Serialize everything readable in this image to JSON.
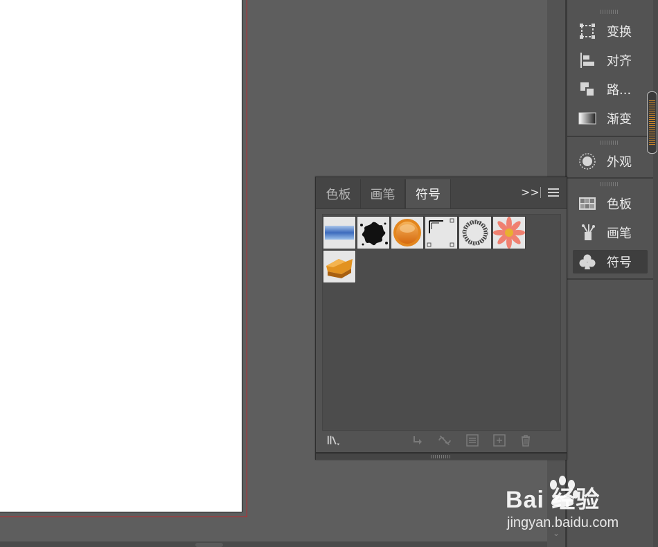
{
  "dock": {
    "group1": [
      {
        "label": "变换",
        "icon": "transform-icon"
      },
      {
        "label": "对齐",
        "icon": "align-icon"
      },
      {
        "label": "路...",
        "icon": "pathfinder-icon"
      },
      {
        "label": "渐变",
        "icon": "gradient-icon"
      }
    ],
    "group2": [
      {
        "label": "外观",
        "icon": "appearance-icon"
      }
    ],
    "group3": [
      {
        "label": "色板",
        "icon": "swatches-icon"
      },
      {
        "label": "画笔",
        "icon": "brushes-icon"
      },
      {
        "label": "符号",
        "icon": "symbols-icon",
        "active": true
      }
    ]
  },
  "panel": {
    "tabs": [
      {
        "label": "色板",
        "active": false
      },
      {
        "label": "画笔",
        "active": false
      },
      {
        "label": "符号",
        "active": true
      }
    ],
    "more_label": ">>",
    "symbols": [
      {
        "name": "blue-bar-symbol"
      },
      {
        "name": "splatter-symbol"
      },
      {
        "name": "orange-button-symbol"
      },
      {
        "name": "frame-corners-symbol"
      },
      {
        "name": "wreath-symbol"
      },
      {
        "name": "flower-symbol"
      },
      {
        "name": "orange-arrow-symbol"
      }
    ],
    "footer_icons": [
      "symbol-library-icon",
      "place-symbol-icon",
      "break-link-icon",
      "symbol-options-icon",
      "new-symbol-icon",
      "delete-icon"
    ]
  },
  "watermark": {
    "brand": "Bai  经验",
    "sub": "jingyan.baidu.com"
  },
  "colors": {
    "accent_red": "#c8252b",
    "panel_bg": "#535353",
    "workspace": "#5e5e5e"
  }
}
